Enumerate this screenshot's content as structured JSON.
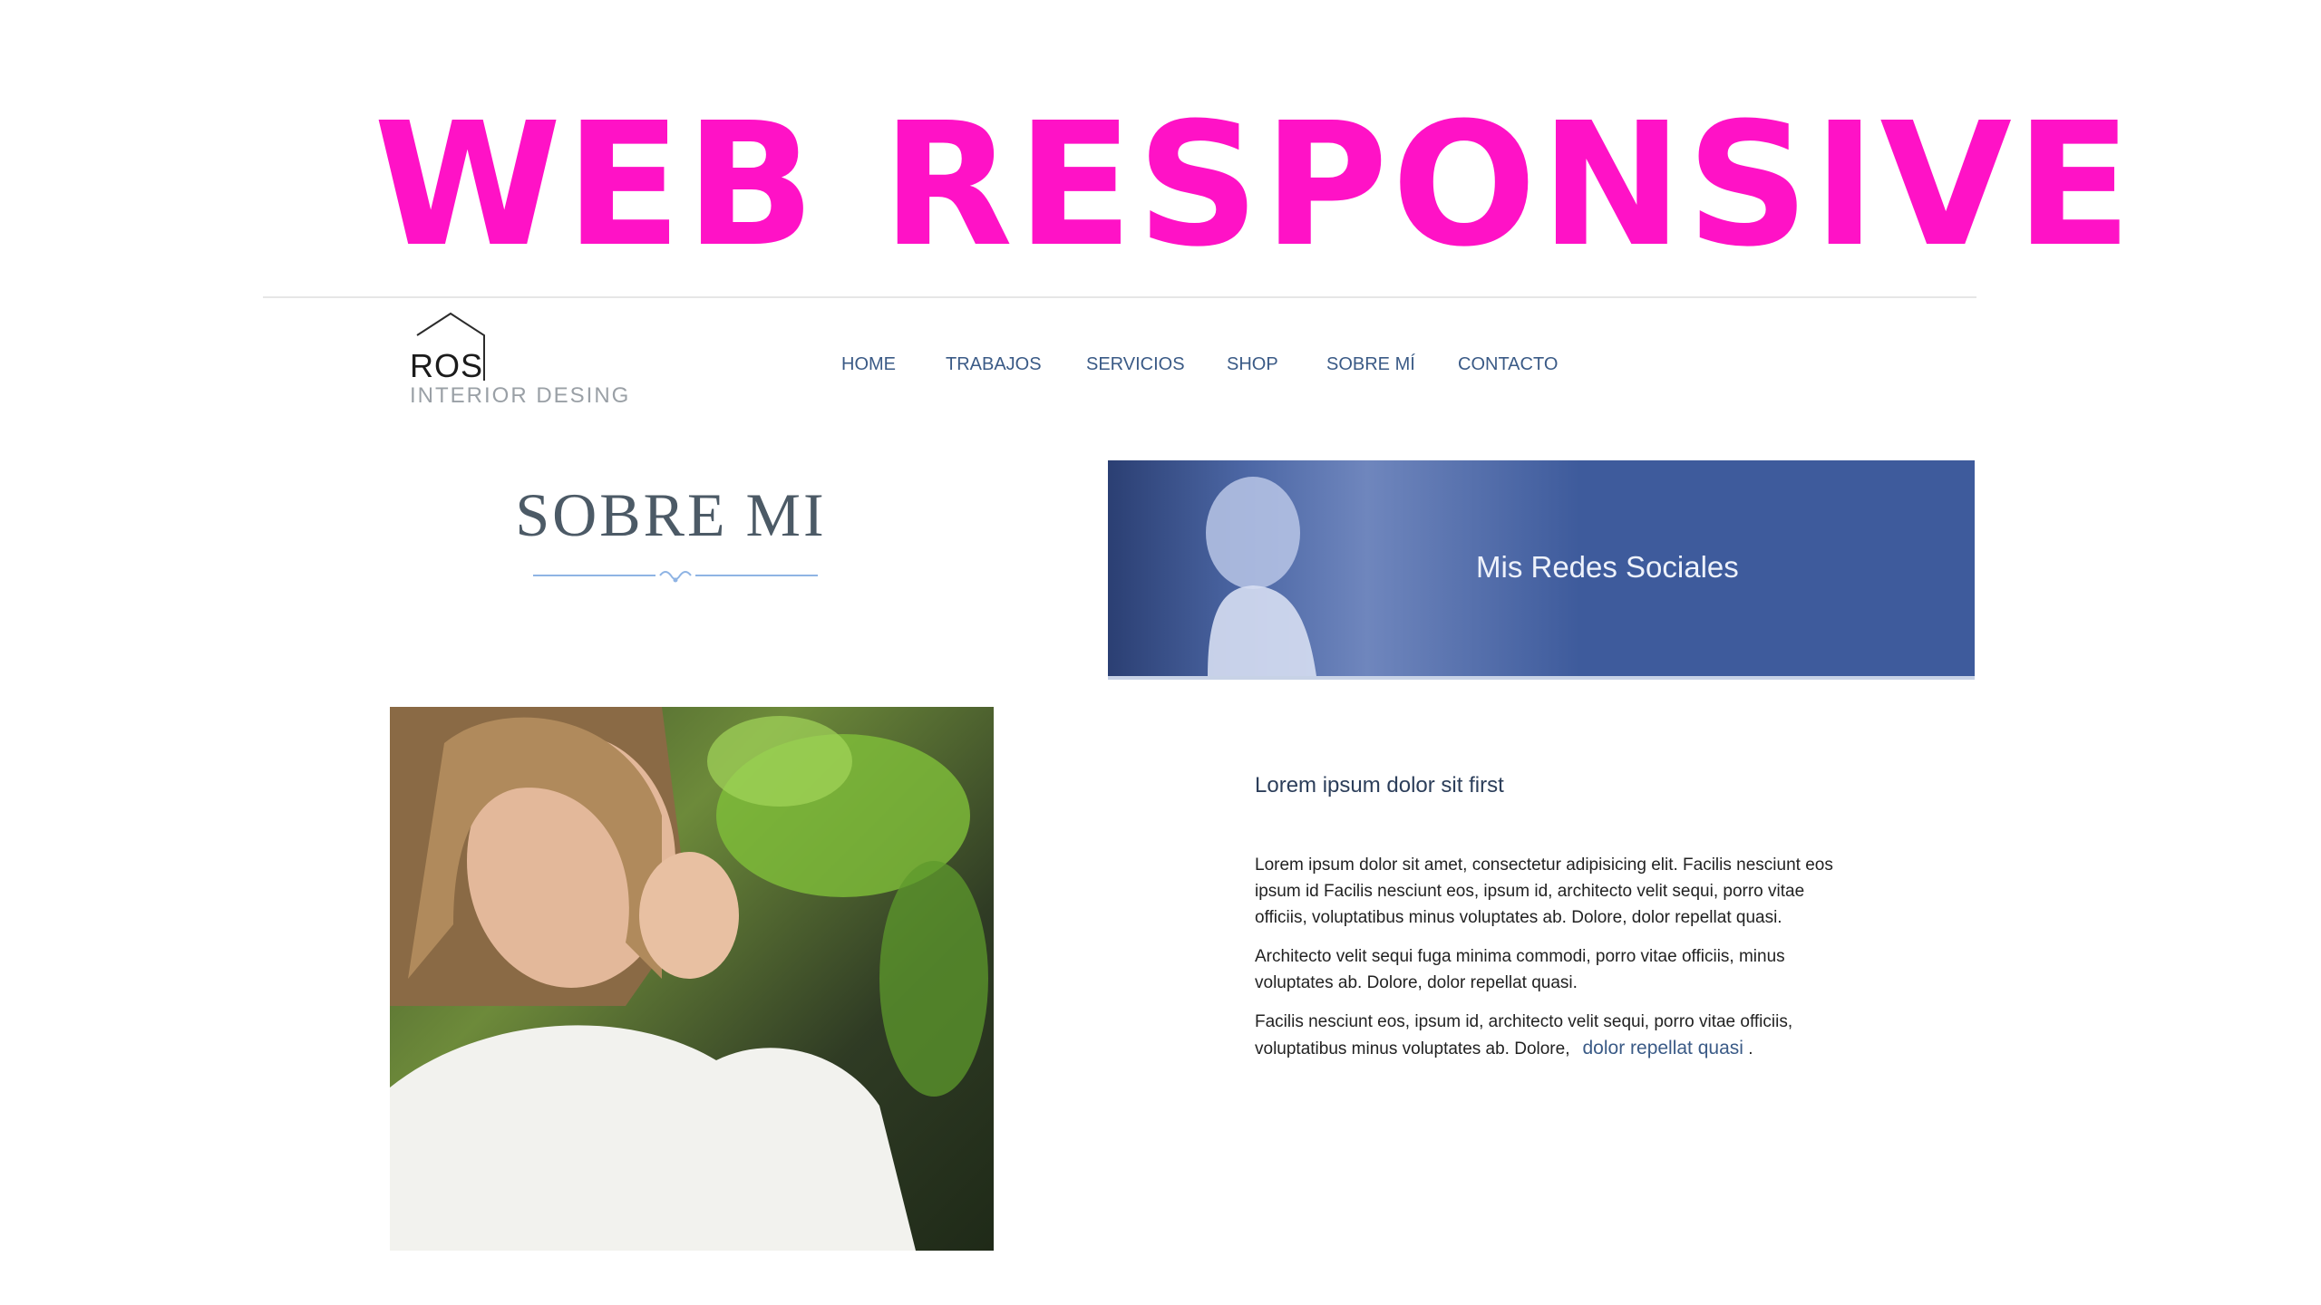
{
  "headline": "WEB RESPONSIVE",
  "logo": {
    "name": "ROS",
    "subtitle": "INTERIOR DESING"
  },
  "nav": {
    "items": [
      {
        "label": "HOME"
      },
      {
        "label": "TRABAJOS"
      },
      {
        "label": "SERVICIOS"
      },
      {
        "label": "SHOP"
      },
      {
        "label": "SOBRE MÍ"
      },
      {
        "label": "CONTACTO"
      }
    ]
  },
  "about": {
    "title": "SOBRE MI"
  },
  "banner": {
    "text": "Mis Redes Sociales"
  },
  "content": {
    "lead": "Lorem ipsum dolor sit first",
    "p1": "Lorem ipsum dolor sit amet, consectetur adipisicing elit. Facilis nesciunt eos ipsum id Facilis nesciunt eos, ipsum id, architecto velit sequi, porro vitae officiis, voluptatibus minus voluptates ab. Dolore, dolor repellat quasi.",
    "p2": "Architecto velit sequi fuga minima commodi, porro vitae officiis, minus voluptates ab. Dolore, dolor repellat quasi.",
    "p3": "Facilis nesciunt eos, ipsum id, architecto velit sequi, porro vitae officiis, voluptatibus minus voluptates ab. Dolore,",
    "p3_link": "dolor repellat quasi",
    "p3_end": "."
  },
  "colors": {
    "headline": "#ff12c6",
    "nav": "#3a5a86",
    "banner": "#3e5b9c",
    "title": "#4c5a66"
  }
}
